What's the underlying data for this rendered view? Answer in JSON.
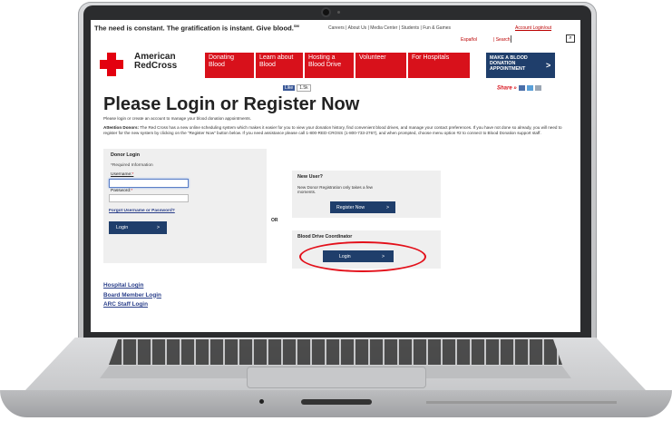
{
  "header": {
    "tagline": "The need is constant. The gratification is instant. Give blood.",
    "tagline_mark": "SM",
    "top_links": [
      "Careers",
      "About Us",
      "Media Center",
      "Students",
      "Fun & Games"
    ],
    "account": "Account Login/out",
    "language": "Español",
    "search_label": "Search"
  },
  "logo": {
    "line1": "American",
    "line2": "RedCross"
  },
  "nav": [
    {
      "line1": "Donating",
      "line2": "Blood"
    },
    {
      "line1": "Learn about",
      "line2": "Blood"
    },
    {
      "line1": "Hosting a",
      "line2": "Blood Drive"
    },
    {
      "line1": "Volunteer",
      "line2": ""
    },
    {
      "line1": "For Hospitals",
      "line2": ""
    }
  ],
  "appointment": {
    "line1": "MAKE A BLOOD",
    "line2": "DONATION",
    "line3": "APPOINTMENT",
    "arrow": ">"
  },
  "social": {
    "like": "Like",
    "count": "1.5k",
    "share": "Share »"
  },
  "page": {
    "title": "Please Login or Register Now",
    "subtitle": "Please login or create an account to manage your blood donation appointments.",
    "attention_label": "Attention Donors:",
    "attention_text": "The Red Cross has a new online scheduling system which makes it easier for you to view your donation history, find convenient blood drives, and manage your contact preferences. If you have not done so already, you will need to register for the new system by clicking on the \"Register Now\" button below. If you need assistance please call 1-800-RED-CROSS (1-800-733-2767), and when prompted, choose menu option #2 to connect to Blood Donation support staff."
  },
  "donor_login": {
    "title": "Donor Login",
    "required": "*Required Information",
    "username_label": "Username:",
    "password_label": "Password:",
    "required_mark": "*",
    "forgot": "Forgot Username or Password?",
    "login_button": "Login",
    "arrow": ">"
  },
  "or_label": "OR",
  "new_user": {
    "title": "New User?",
    "text": "New Donor Registration only takes a few moments.",
    "button": "Register Now",
    "arrow": ">"
  },
  "coordinator": {
    "title": "Blood Drive Coordinator",
    "button": "Login",
    "arrow": ">"
  },
  "other_logins": [
    "Hospital Login",
    "Board Member Login",
    "ARC Staff Login"
  ],
  "colors": {
    "brand_red": "#d8111b",
    "navy": "#1f3e6b",
    "highlight_ring": "#e3101a"
  }
}
